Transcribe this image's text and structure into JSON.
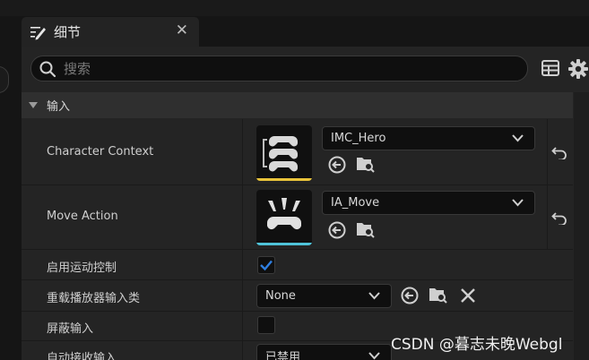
{
  "tab": {
    "title": "细节"
  },
  "search": {
    "placeholder": "搜索"
  },
  "category": {
    "label": "输入"
  },
  "rows": [
    {
      "label": "Character Context",
      "value": "IMC_Hero"
    },
    {
      "label": "Move Action",
      "value": "IA_Move"
    },
    {
      "label": "启用运动控制",
      "checked": true
    },
    {
      "label": "重载播放器输入类",
      "value": "None"
    },
    {
      "label": "屏蔽输入",
      "checked": false
    },
    {
      "label": "自动接收输入",
      "value": "已禁用"
    }
  ],
  "colors": {
    "accent_yellow": "#e8c33a",
    "accent_cyan": "#4fc3d9",
    "check_blue": "#2f7fe0"
  },
  "watermark": {
    "text": "CSDN @暮志未晚Webgl"
  }
}
